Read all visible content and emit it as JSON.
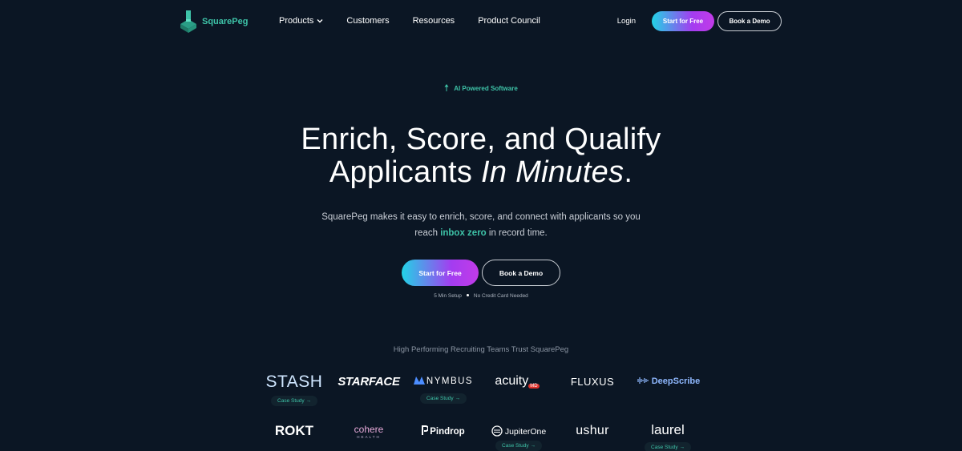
{
  "nav": {
    "brand": "SquarePeg",
    "links": [
      "Products",
      "Customers",
      "Resources",
      "Product Council"
    ],
    "login": "Login",
    "start_label": "Start for Free",
    "demo_label": "Book a Demo"
  },
  "hero": {
    "badge": "AI Powered Software",
    "headline_line1": "Enrich, Score, and Qualify",
    "headline_line2_plain": "Applicants ",
    "headline_line2_italic": "In Minutes",
    "headline_line2_end": ".",
    "sub_line1": "SquarePeg makes it easy to enrich, score, and connect with applicants so you",
    "sub_line2_pre": "reach ",
    "sub_line2_highlight": "inbox zero",
    "sub_line2_post": " in record time.",
    "start_label": "Start for Free",
    "demo_label": "Book a Demo",
    "fine_left": "5 Min Setup",
    "fine_right": "No Credit Card Needed"
  },
  "trust": {
    "heading": "High Performing Recruiting Teams Trust SquarePeg",
    "case_study_label": "Case Study →",
    "row1": [
      "STASH",
      "STARFACE",
      "NYMBUS",
      "acuity",
      "FLUXUS",
      "DeepScribe"
    ],
    "row2": [
      "ROKT",
      "cohere",
      "Pindrop",
      "JupiterOne",
      "ushur",
      "laurel"
    ],
    "acuity_badge": "MD",
    "cohere_sub": "HEALTH"
  },
  "colors": {
    "background": "#0b1624",
    "accent": "#3ec3a8",
    "gradient_start": "#22d3e6",
    "gradient_end": "#c23be8"
  }
}
